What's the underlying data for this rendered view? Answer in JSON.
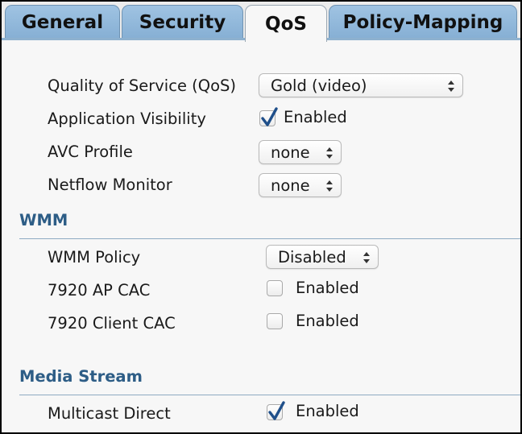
{
  "tabs": [
    {
      "label": "General"
    },
    {
      "label": "Security"
    },
    {
      "label": "QoS"
    },
    {
      "label": "Policy-Mapping"
    }
  ],
  "active_tab": "QoS",
  "qos": {
    "label": "Quality of Service (QoS)",
    "value": "Gold (video)"
  },
  "app_visibility": {
    "label": "Application Visibility",
    "checked": true,
    "checkbox_label": "Enabled"
  },
  "avc_profile": {
    "label": "AVC Profile",
    "value": "none"
  },
  "netflow_monitor": {
    "label": "Netflow Monitor",
    "value": "none"
  },
  "wmm": {
    "title": "WMM",
    "policy": {
      "label": "WMM Policy",
      "value": "Disabled"
    },
    "ap_cac": {
      "label": "7920 AP CAC",
      "checked": false,
      "checkbox_label": "Enabled"
    },
    "client_cac": {
      "label": "7920 Client CAC",
      "checked": false,
      "checkbox_label": "Enabled"
    }
  },
  "media_stream": {
    "title": "Media Stream",
    "multicast_direct": {
      "label": "Multicast Direct",
      "checked": true,
      "checkbox_label": "Enabled"
    }
  },
  "colors": {
    "tab_inactive": "#9fc3e2",
    "section_title": "#2d5d86",
    "checkmark": "#1f4f8a"
  },
  "icons": {
    "select_arrows": "up-down-arrows-icon",
    "checkmark": "checkmark-icon"
  }
}
